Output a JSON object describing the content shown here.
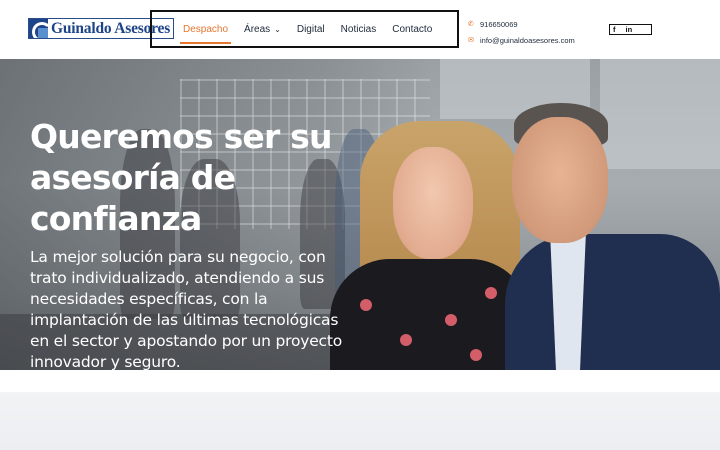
{
  "brand": {
    "name": "Guinaldo Asesores"
  },
  "nav": {
    "items": [
      {
        "label": "Despacho",
        "active": true
      },
      {
        "label": "Áreas",
        "has_dropdown": true
      },
      {
        "label": "Digital"
      },
      {
        "label": "Noticias"
      },
      {
        "label": "Contacto"
      }
    ]
  },
  "contact": {
    "phone": "916650069",
    "email": "info@guinaldoasesores.com",
    "phone_icon": "phone-icon",
    "email_icon": "envelope-icon"
  },
  "social": {
    "facebook": "f",
    "linkedin": "in"
  },
  "hero": {
    "title": "Queremos ser su asesoría de confianza",
    "description": "La mejor solución para su negocio, con trato individualizado, atendiendo a sus necesidades específicas, con la implantación de las últimas tecnológicas en el sector y apostando por un proyecto innovador y seguro."
  },
  "colors": {
    "accent": "#e5772f",
    "brand": "#1d4489",
    "text": "#1e2a3a"
  }
}
